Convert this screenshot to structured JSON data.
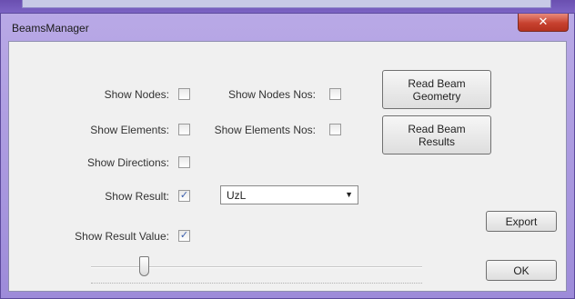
{
  "window": {
    "title": "BeamsManager",
    "close_glyph": "✕"
  },
  "checkboxes": {
    "show_nodes": {
      "label": "Show Nodes:",
      "checked": false
    },
    "show_nodes_nos": {
      "label": "Show Nodes Nos:",
      "checked": false
    },
    "show_elements": {
      "label": "Show Elements:",
      "checked": false
    },
    "show_elements_nos": {
      "label": "Show Elements Nos:",
      "checked": false
    },
    "show_directions": {
      "label": "Show Directions:",
      "checked": false
    },
    "show_result": {
      "label": "Show Result:",
      "checked": true,
      "mark": "✓"
    },
    "show_result_value": {
      "label": "Show Result Value:",
      "checked": true,
      "mark": "✓"
    }
  },
  "buttons": {
    "read_geometry": "Read Beam Geometry",
    "read_results": "Read Beam Results",
    "export": "Export",
    "ok": "OK"
  },
  "result_select": {
    "value": "UzL",
    "arrow": "▼"
  },
  "slider": {
    "position_fraction": 0.16
  },
  "icons": {
    "close": "close-icon",
    "dropdown": "chevron-down-icon",
    "check": "checkmark-icon"
  },
  "colors": {
    "frame": "#9d8bd9",
    "close_button": "#c7412f",
    "client_bg": "#f0f0f0",
    "check_mark": "#3b5fae"
  }
}
